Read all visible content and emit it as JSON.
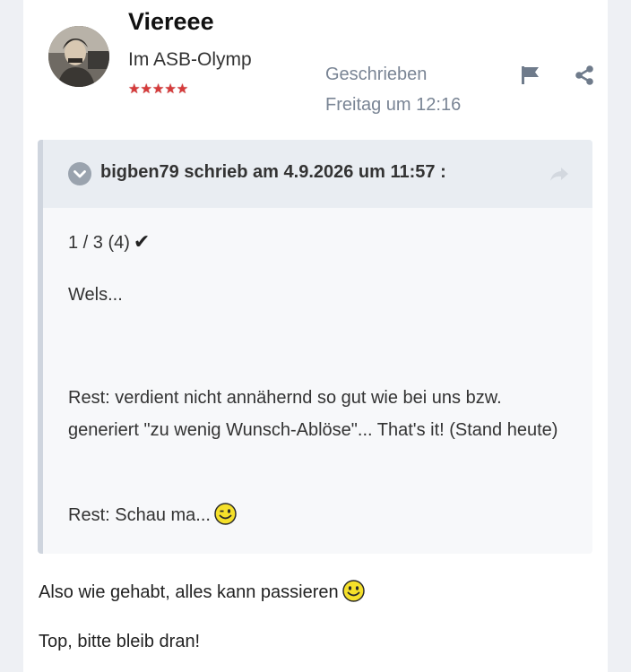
{
  "post": {
    "author": "Viereee",
    "rank": "Im ASB-Olymp",
    "stars": "★★★★★",
    "posted_label": "Geschrieben",
    "posted_date": "Freitag um 12:16",
    "body": [
      "Also wie gehabt, alles kann passieren",
      "Top, bitte bleib dran!"
    ]
  },
  "quote": {
    "citation": "bigben79 schrieb am 4.9.2026 um 11:57 :",
    "lines": [
      "1 / 3 (4)",
      "Wels...",
      "Rest: verdient nicht annähernd so gut wie bei uns bzw. generiert \"zu wenig Wunsch-Ablöse\"... That's it! (Stand heute)",
      "Rest: Schau ma..."
    ],
    "check": "✔"
  },
  "icons": {
    "avatar": "avatar-photo",
    "flag": "flag-icon",
    "share": "share-icon",
    "toggle": "chevron-down-circle-icon",
    "jump": "forward-arrow-icon",
    "wink": "wink-smiley-icon",
    "smile": "smile-smiley-icon"
  },
  "colors": {
    "meta_text": "#7a8595",
    "stars": "#d63a3a",
    "quote_border": "#cfd5de",
    "quote_header_bg": "#e9edf2"
  }
}
